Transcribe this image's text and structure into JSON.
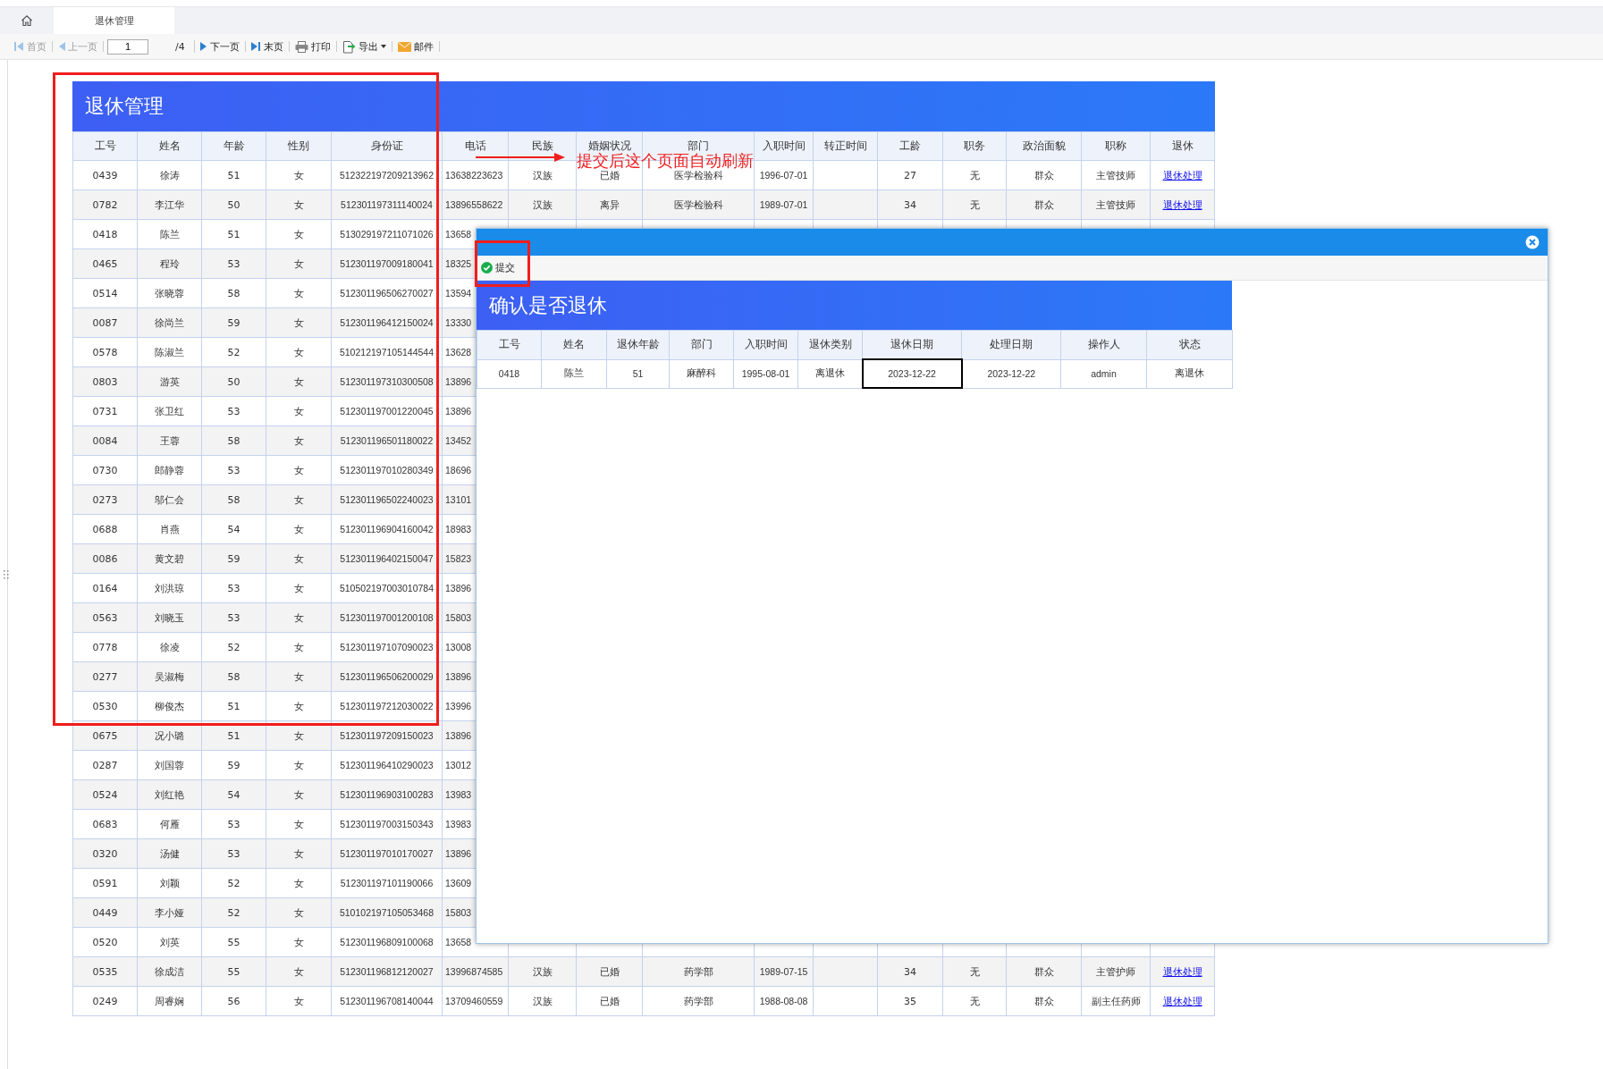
{
  "tabs": [
    {
      "kind": "home",
      "selected": false
    },
    {
      "kind": "text",
      "label": "退休管理",
      "selected": true
    }
  ],
  "toolbar": [
    {
      "kind": "first",
      "label": "首页",
      "disabled": true
    },
    {
      "kind": "prev",
      "label": "上一页",
      "disabled": true
    },
    {
      "kind": "page",
      "value": "1",
      "total": "/4"
    },
    {
      "kind": "next",
      "label": "下一页",
      "disabled": false
    },
    {
      "kind": "last",
      "label": "末页",
      "disabled": false
    },
    {
      "kind": "print",
      "label": "打印",
      "disabled": false
    },
    {
      "kind": "export",
      "label": "导出",
      "disabled": false
    },
    {
      "kind": "mail",
      "label": "邮件",
      "disabled": false
    }
  ],
  "report": {
    "title": "退休管理",
    "columns": [
      "工号",
      "姓名",
      "年龄",
      "性别",
      "身份证",
      "电话",
      "民族",
      "婚姻状况",
      "部门",
      "入职时间",
      "转正时间",
      "工龄",
      "职务",
      "政治面貌",
      "职称",
      "退休"
    ],
    "rows": [
      {
        "cells": [
          "0439",
          "徐涛",
          "51",
          "女",
          "512322197209213962",
          "13638223623",
          "汉族",
          "已婚",
          "医学检验科",
          "1996-07-01",
          null,
          "27",
          "无",
          "群众",
          "主管技师",
          "退休处理"
        ]
      },
      {
        "cells": [
          "0782",
          "李江华",
          "50",
          "女",
          "512301197311140024",
          "13896558622",
          "汉族",
          "离异",
          "医学检验科",
          "1989-07-01",
          null,
          "34",
          "无",
          "群众",
          "主管技师",
          "退休处理"
        ]
      },
      {
        "cells": [
          "0418",
          "陈兰",
          "51",
          "女",
          "513029197211071026",
          "13658"
        ]
      },
      {
        "cells": [
          "0465",
          "程玲",
          "53",
          "女",
          "512301197009180041",
          "18325"
        ]
      },
      {
        "cells": [
          "0514",
          "张晓蓉",
          "58",
          "女",
          "512301196506270027",
          "13594"
        ]
      },
      {
        "cells": [
          "0087",
          "徐尚兰",
          "59",
          "女",
          "512301196412150024",
          "13330"
        ]
      },
      {
        "cells": [
          "0578",
          "陈淑兰",
          "52",
          "女",
          "510212197105144544",
          "13628"
        ]
      },
      {
        "cells": [
          "0803",
          "游英",
          "50",
          "女",
          "512301197310300508",
          "13896"
        ]
      },
      {
        "cells": [
          "0731",
          "张卫红",
          "53",
          "女",
          "512301197001220045",
          "13896"
        ]
      },
      {
        "cells": [
          "0084",
          "王蓉",
          "58",
          "女",
          "512301196501180022",
          "13452"
        ]
      },
      {
        "cells": [
          "0730",
          "郎静蓉",
          "53",
          "女",
          "512301197010280349",
          "18696"
        ]
      },
      {
        "cells": [
          "0273",
          "邬仁会",
          "58",
          "女",
          "512301196502240023",
          "13101"
        ]
      },
      {
        "cells": [
          "0688",
          "肖燕",
          "54",
          "女",
          "512301196904160042",
          "18983"
        ]
      },
      {
        "cells": [
          "0086",
          "黄文碧",
          "59",
          "女",
          "512301196402150047",
          "15823"
        ]
      },
      {
        "cells": [
          "0164",
          "刘洪琼",
          "53",
          "女",
          "510502197003010784",
          "13896"
        ]
      },
      {
        "cells": [
          "0563",
          "刘晓玉",
          "53",
          "女",
          "512301197001200108",
          "15803"
        ]
      },
      {
        "cells": [
          "0778",
          "徐凌",
          "52",
          "女",
          "512301197107090023",
          "13008"
        ]
      },
      {
        "cells": [
          "0277",
          "吴淑梅",
          "58",
          "女",
          "512301196506200029",
          "13896"
        ]
      },
      {
        "cells": [
          "0530",
          "柳俊杰",
          "51",
          "女",
          "512301197212030022",
          "13996"
        ]
      },
      {
        "cells": [
          "0675",
          "况小璐",
          "51",
          "女",
          "512301197209150023",
          "13896"
        ]
      },
      {
        "cells": [
          "0287",
          "刘国蓉",
          "59",
          "女",
          "512301196410290023",
          "13012"
        ]
      },
      {
        "cells": [
          "0524",
          "刘红艳",
          "54",
          "女",
          "512301196903100283",
          "13983"
        ]
      },
      {
        "cells": [
          "0683",
          "何雁",
          "53",
          "女",
          "512301197003150343",
          "13983"
        ]
      },
      {
        "cells": [
          "0320",
          "汤健",
          "53",
          "女",
          "512301197010170027",
          "13896"
        ]
      },
      {
        "cells": [
          "0591",
          "刘颖",
          "52",
          "女",
          "512301197101190066",
          "13609"
        ]
      },
      {
        "cells": [
          "0449",
          "李小娅",
          "52",
          "女",
          "510102197105053468",
          "15803"
        ]
      },
      {
        "cells": [
          "0520",
          "刘英",
          "55",
          "女",
          "512301196809100068",
          "13658"
        ]
      },
      {
        "cells": [
          "0535",
          "徐成洁",
          "55",
          "女",
          "512301196812120027",
          "13996874585",
          "汉族",
          "已婚",
          "药学部",
          "1989-07-15",
          null,
          "34",
          "无",
          "群众",
          "主管护师",
          "退休处理"
        ]
      },
      {
        "cells": [
          "0249",
          "周睿娴",
          "56",
          "女",
          "512301196708140044",
          "13709460559",
          "汉族",
          "已婚",
          "药学部",
          "1988-08-08",
          null,
          "35",
          "无",
          "群众",
          "副主任药师",
          "退休处理"
        ]
      }
    ]
  },
  "dialog": {
    "submit_label": "提交",
    "title": "确认是否退休",
    "columns": [
      "工号",
      "姓名",
      "退休年龄",
      "部门",
      "入职时间",
      "退休类别",
      "退休日期",
      "处理日期",
      "操作人",
      "状态"
    ],
    "rows": [
      {
        "cells": [
          {
            "text": "0418",
            "focused": false
          },
          {
            "text": "陈兰",
            "focused": false
          },
          {
            "text": "51",
            "focused": false
          },
          {
            "text": "麻醉科",
            "focused": false
          },
          {
            "text": "1995-08-01",
            "focused": false
          },
          {
            "text": "离退休",
            "focused": false
          },
          {
            "text": "2023-12-22",
            "focused": true
          },
          {
            "text": "2023-12-22",
            "focused": false
          },
          {
            "text": "admin",
            "focused": false
          },
          {
            "text": "离退休",
            "focused": false
          }
        ]
      }
    ]
  },
  "annotations": [
    {
      "kind": "box"
    },
    {
      "kind": "box"
    },
    {
      "kind": "arrow",
      "text": "提交后这个页面自动刷新"
    }
  ]
}
